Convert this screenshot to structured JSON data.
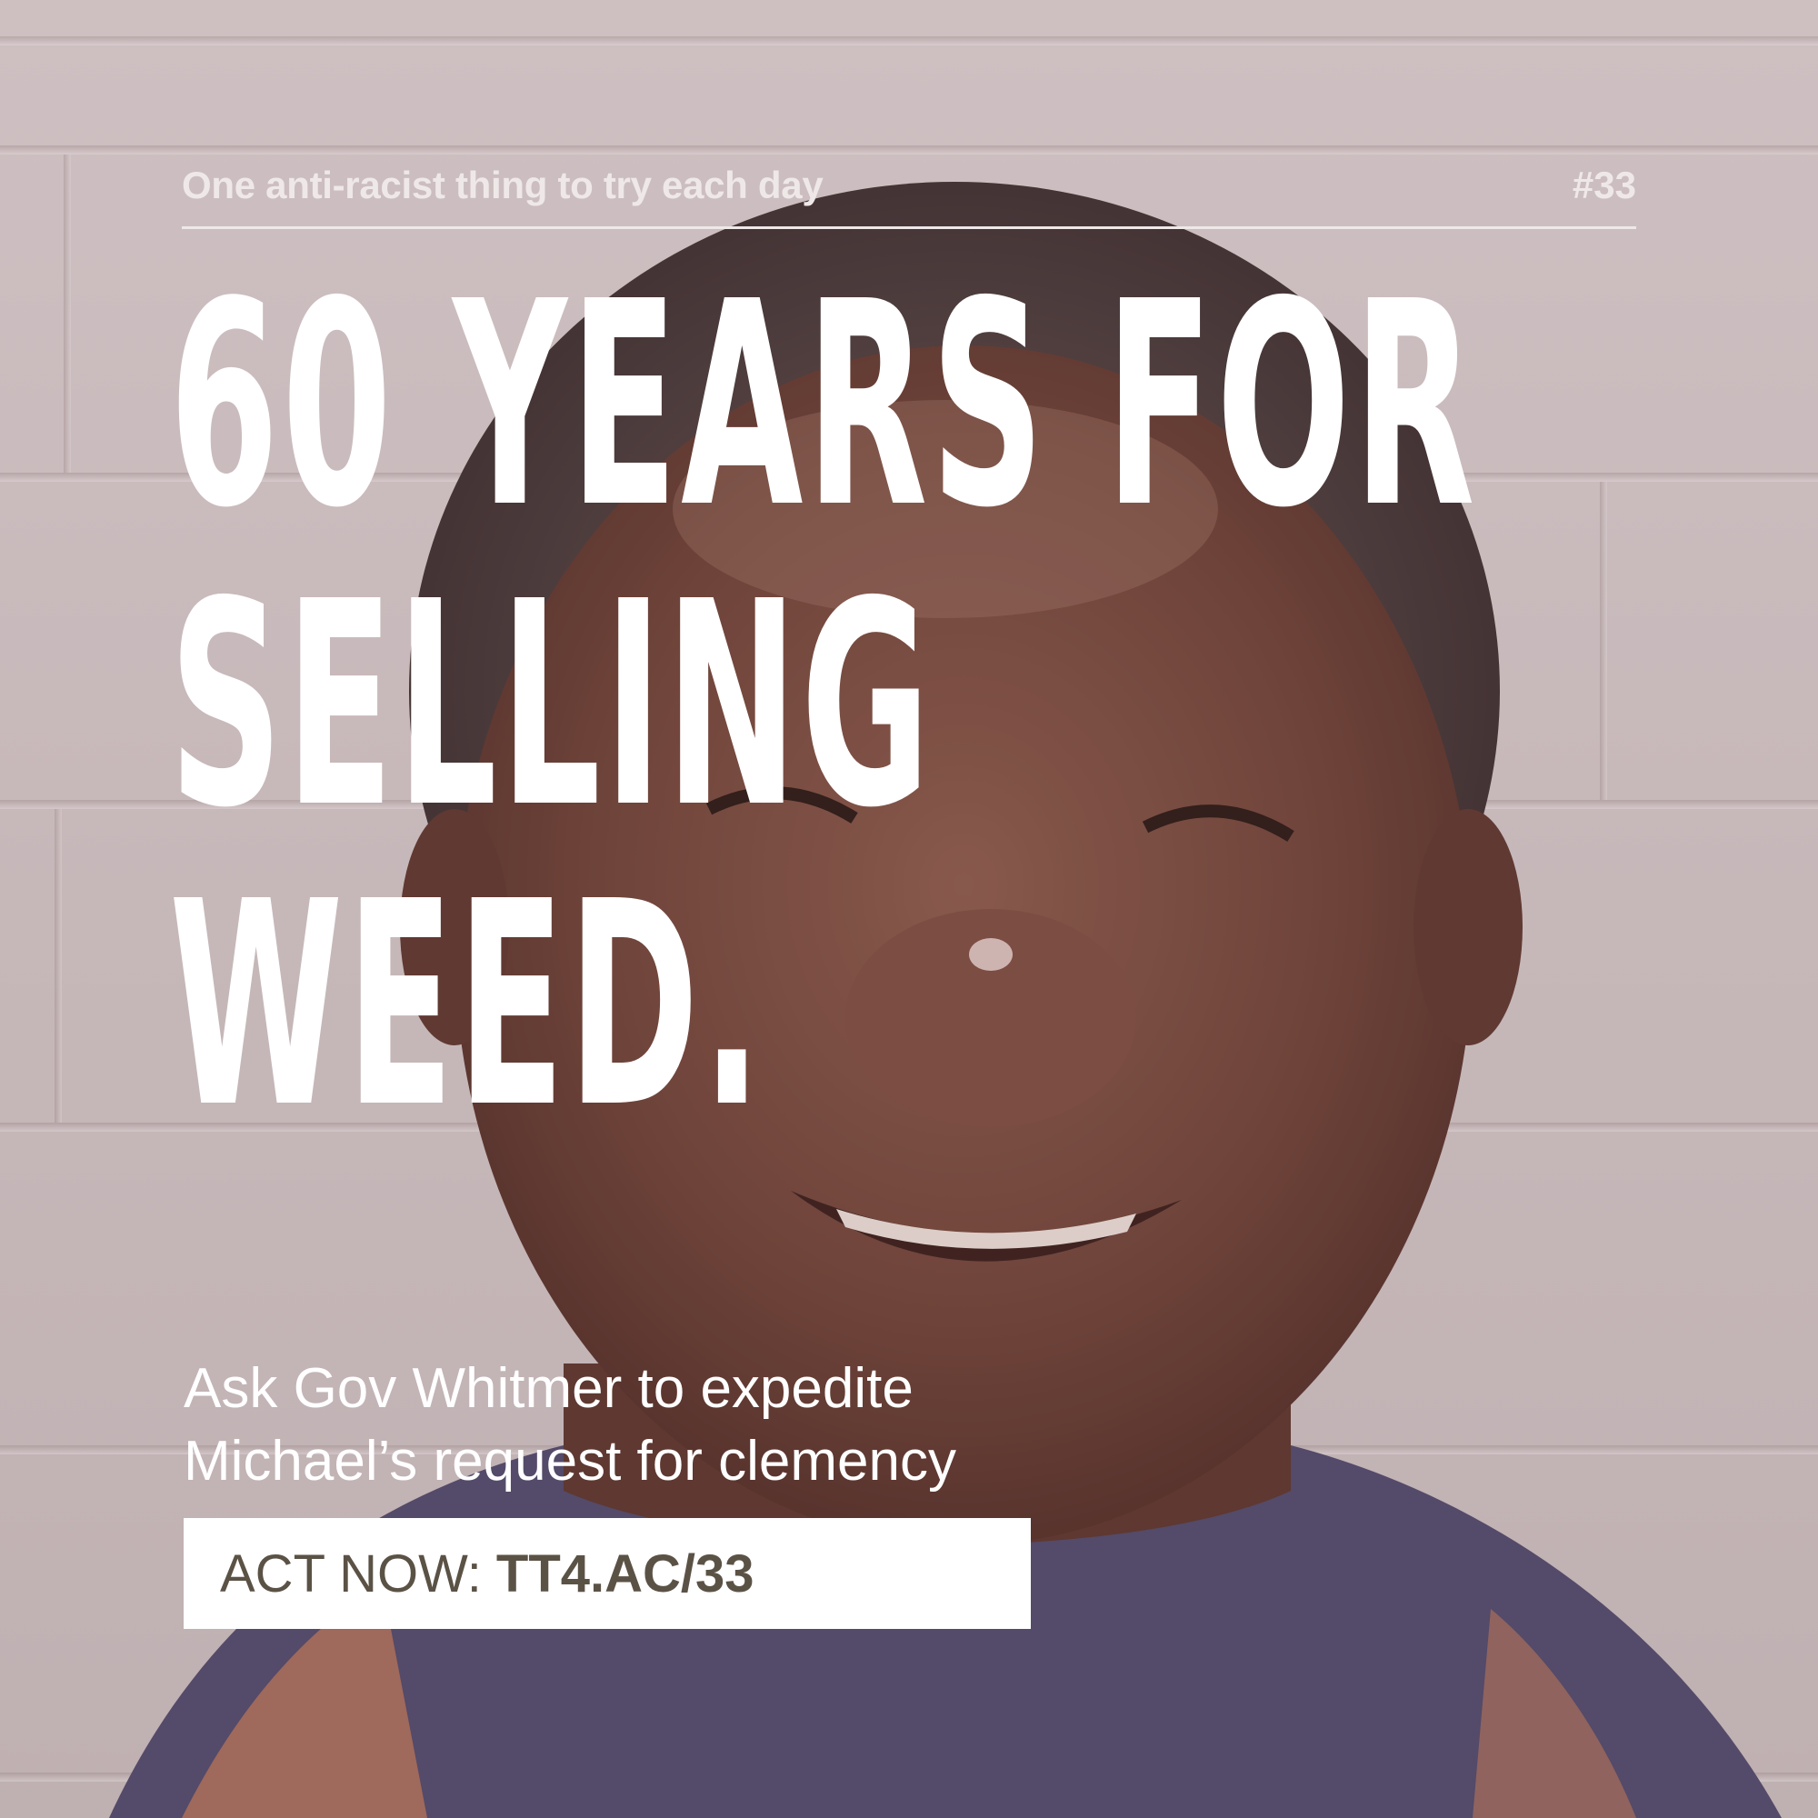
{
  "header": {
    "tagline": "One anti-racist thing to try each day",
    "issue_number": "#33"
  },
  "headline": {
    "lines": [
      "60 YEARS FOR",
      "SELLING",
      "WEED."
    ]
  },
  "body": {
    "lines": [
      "Ask Gov Whitmer to expedite",
      "Michael’s request for clemency"
    ]
  },
  "cta": {
    "label": "ACT NOW:",
    "url": "TT4.AC/33"
  },
  "colors": {
    "text_light": "#ffffff",
    "cta_text": "#5b5246",
    "wall": "#d0c4c6"
  },
  "image": {
    "subject": "smiling-man-photo"
  }
}
